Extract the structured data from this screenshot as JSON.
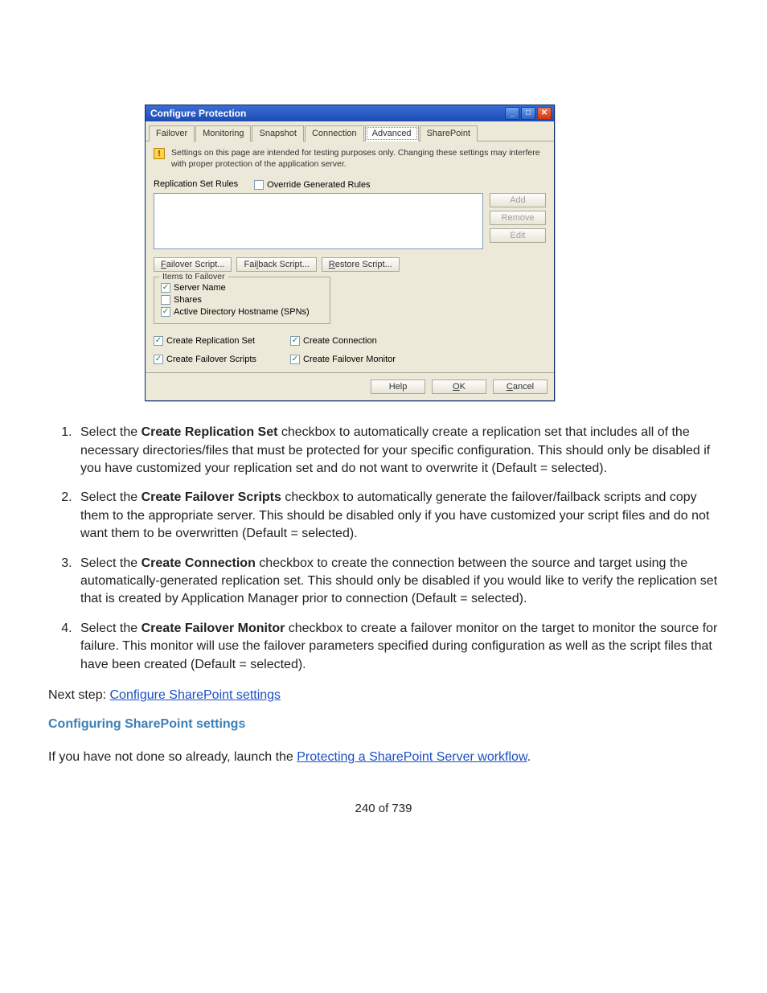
{
  "dialog": {
    "title": "Configure Protection",
    "tabs": [
      "Failover",
      "Monitoring",
      "Snapshot",
      "Connection",
      "Advanced",
      "SharePoint"
    ],
    "active_tab": "Advanced",
    "warning": "Settings on this page are intended for testing purposes only.  Changing these settings may interfere with proper protection of the application server.",
    "rules_label": "Replication Set Rules",
    "override_label": "Override Generated Rules",
    "override_checked": false,
    "side_buttons": {
      "add": "Add",
      "remove": "Remove",
      "edit": "Edit"
    },
    "script_buttons": {
      "failover": "Failover Script...",
      "failback": "Failback Script...",
      "restore": "Restore Script..."
    },
    "items_legend": "Items to Failover",
    "items": [
      {
        "label": "Server Name",
        "checked": true
      },
      {
        "label": "Shares",
        "checked": false
      },
      {
        "label": "Active Directory Hostname (SPNs)",
        "checked": true
      }
    ],
    "create": [
      {
        "label": "Create Replication Set",
        "checked": true
      },
      {
        "label": "Create Connection",
        "checked": true
      },
      {
        "label": "Create Failover Scripts",
        "checked": true
      },
      {
        "label": "Create Failover Monitor",
        "checked": true
      }
    ],
    "footer": {
      "help": "Help",
      "ok": "OK",
      "cancel": "Cancel"
    }
  },
  "doc": {
    "items": [
      {
        "pre": "Select the ",
        "bold": "Create Replication Set",
        "post": " checkbox to automatically create a replication set that includes all of the necessary directories/files that must be protected for your specific configuration. This should only be disabled if you have customized your replication set and do not want to overwrite it (Default = selected)."
      },
      {
        "pre": "Select the ",
        "bold": "Create Failover Scripts",
        "post": " checkbox to automatically generate the failover/failback scripts and copy them to the appropriate server. This should be disabled only if you have customized your script files and do not want them to be overwritten (Default = selected)."
      },
      {
        "pre": "Select the ",
        "bold": "Create Connection",
        "post": " checkbox to create the connection between the source and target using the automatically-generated replication set. This should only be disabled if you would like to verify the replication set that is created by Application Manager prior to connection (Default = selected)."
      },
      {
        "pre": "Select the ",
        "bold": "Create Failover Monitor",
        "post": " checkbox to create a failover monitor on the target to monitor the source for failure. This monitor will use the failover parameters specified during configuration as well as the script files that have been created (Default = selected)."
      }
    ],
    "next_prefix": "Next step: ",
    "next_link": "Configure SharePoint settings",
    "section_heading": "Configuring SharePoint settings",
    "para_prefix": "If you have not done so already, launch the ",
    "para_link": "Protecting a SharePoint Server workflow",
    "para_suffix": ".",
    "page_number": "240 of 739"
  }
}
